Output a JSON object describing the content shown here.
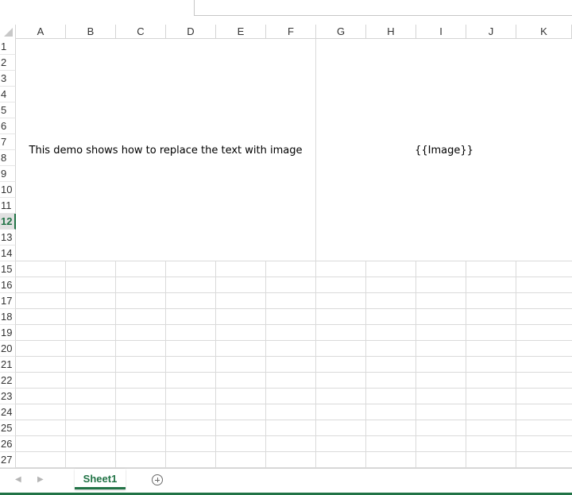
{
  "columns": [
    "A",
    "B",
    "C",
    "D",
    "E",
    "F",
    "G",
    "H",
    "I",
    "J",
    "K"
  ],
  "rows": [
    "1",
    "2",
    "3",
    "4",
    "5",
    "6",
    "7",
    "8",
    "9",
    "10",
    "11",
    "12",
    "13",
    "14",
    "15",
    "16",
    "17",
    "18",
    "19",
    "20",
    "21",
    "22",
    "23",
    "24",
    "25",
    "26",
    "27"
  ],
  "active_row": "12",
  "cells": {
    "merged_left_text": "This demo shows how to replace the text with image",
    "merged_right_text": "{{Image}}"
  },
  "sheet_tabs": [
    "Sheet1"
  ],
  "active_sheet": "Sheet1",
  "icons": [
    "add-sheet-icon",
    "scroll-left-icon",
    "scroll-right-icon"
  ],
  "colors": {
    "accent": "#217346",
    "gridline": "#dadada",
    "header_border": "#d4d4d4"
  }
}
